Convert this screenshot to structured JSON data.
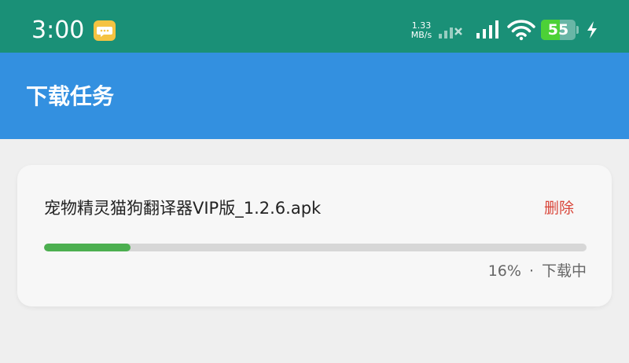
{
  "status_bar": {
    "time": "3:00",
    "net_speed_value": "1.33",
    "net_speed_unit": "MB/s",
    "battery_level": "55",
    "battery_fraction": 0.55,
    "icons": [
      "message-icon",
      "signal-weak-icon",
      "signal-icon",
      "wifi-icon",
      "battery-icon",
      "charging-icon"
    ],
    "background_color": "#1a9077"
  },
  "app_bar": {
    "title": "下载任务",
    "background_color": "#3390e0"
  },
  "download": {
    "file_name": "宠物精灵猫狗翻译器VIP版_1.2.6.apk",
    "delete_label": "删除",
    "progress_fraction": 0.16,
    "progress_text": "16%",
    "separator": "·",
    "status": "下载中",
    "progress_color": "#4caf50",
    "delete_color": "#d9463a"
  }
}
